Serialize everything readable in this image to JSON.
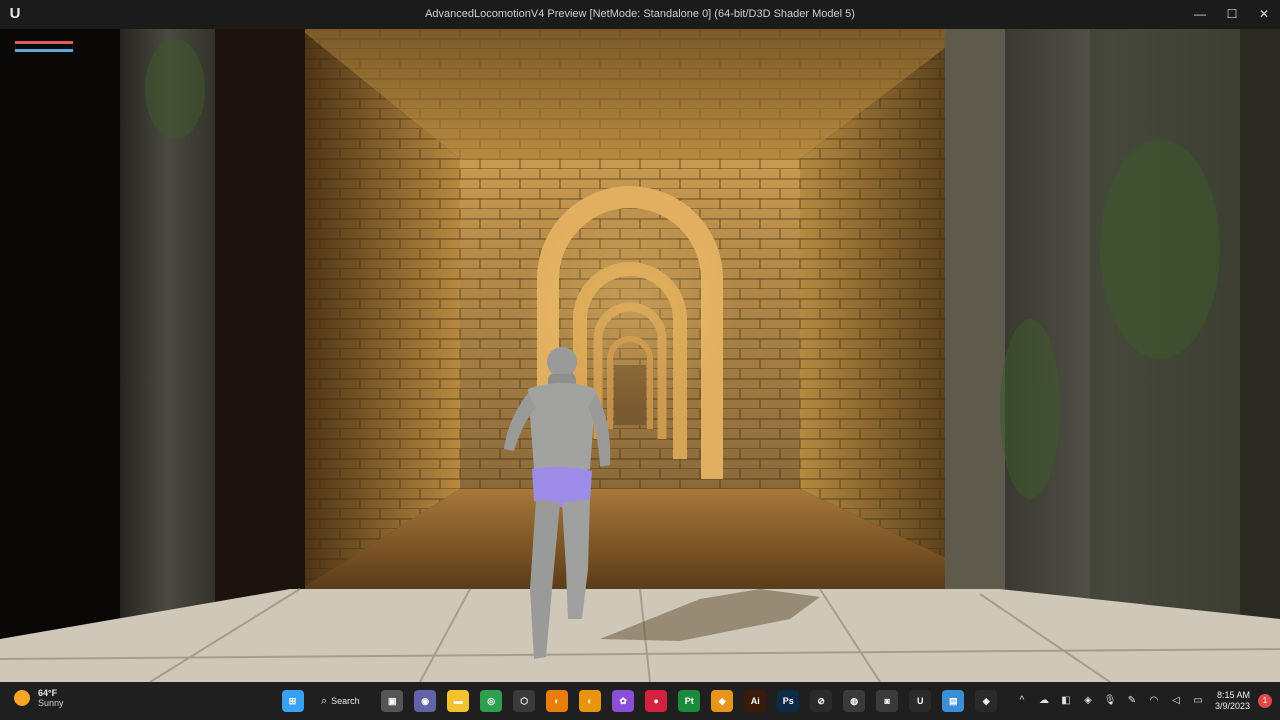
{
  "window": {
    "app_logo": "U",
    "title": "AdvancedLocomotionV4 Preview [NetMode: Standalone 0]  (64-bit/D3D Shader Model 5)",
    "minimize": "—",
    "maximize": "☐",
    "close": "✕"
  },
  "hud": {
    "health_color": "#e05a5a",
    "stamina_color": "#5fa8e0"
  },
  "taskbar": {
    "weather": {
      "temp": "64°F",
      "condition": "Sunny"
    },
    "search_label": "Search",
    "apps": [
      {
        "name": "start",
        "glyph": "⊞",
        "color": "#3aa0f0"
      },
      {
        "name": "task-view",
        "glyph": "▣",
        "color": "#555"
      },
      {
        "name": "teams",
        "glyph": "◉",
        "color": "#6264a7"
      },
      {
        "name": "file-explorer",
        "glyph": "▬",
        "color": "#f2c230"
      },
      {
        "name": "chrome",
        "glyph": "◎",
        "color": "#2e9e4f"
      },
      {
        "name": "unity",
        "glyph": "⬡",
        "color": "#3a3a3a"
      },
      {
        "name": "blender",
        "glyph": "◐",
        "color": "#e87d0d"
      },
      {
        "name": "blender-2",
        "glyph": "◐",
        "color": "#e8940d"
      },
      {
        "name": "obs",
        "glyph": "✿",
        "color": "#8a4fd6"
      },
      {
        "name": "record",
        "glyph": "●",
        "color": "#d4213d"
      },
      {
        "name": "pycharm",
        "glyph": "Pt",
        "color": "#1c8a3c"
      },
      {
        "name": "box-app",
        "glyph": "◆",
        "color": "#e8951b"
      },
      {
        "name": "illustrator",
        "glyph": "Ai",
        "color": "#3a1a08"
      },
      {
        "name": "photoshop",
        "glyph": "Ps",
        "color": "#0e2a47"
      },
      {
        "name": "compass-app",
        "glyph": "⊘",
        "color": "#2a2a2a"
      },
      {
        "name": "davinci",
        "glyph": "◍",
        "color": "#3a3a3a"
      },
      {
        "name": "camera-app",
        "glyph": "◙",
        "color": "#3a3a3a"
      },
      {
        "name": "unreal",
        "glyph": "U",
        "color": "#2a2a2a"
      },
      {
        "name": "notepad",
        "glyph": "▤",
        "color": "#3b8fd6"
      },
      {
        "name": "discord",
        "glyph": "◈",
        "color": "#2a2a2a"
      }
    ],
    "tray": {
      "chevron": "^",
      "time": "8:15 AM",
      "date": "3/9/2023",
      "notification": "1"
    }
  }
}
